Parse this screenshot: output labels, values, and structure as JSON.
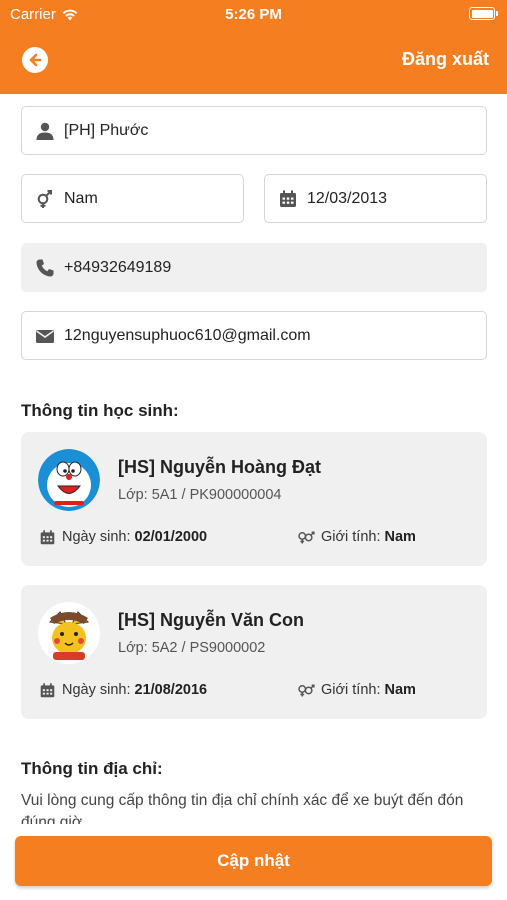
{
  "status_bar": {
    "carrier": "Carrier",
    "time": "5:26 PM"
  },
  "header": {
    "logout_label": "Đăng xuất"
  },
  "form": {
    "name": "[PH] Phước",
    "gender": "Nam",
    "birthday": "12/03/2013",
    "phone": "+84932649189",
    "email": "12nguyensuphuoc610@gmail.com"
  },
  "students_section": {
    "title": "Thông tin học sinh:",
    "students": [
      {
        "name": "[HS] Nguyễn Hoàng Đạt",
        "class": "Lớp: 5A1 / PK900000004",
        "dob_label": "Ngày sinh:",
        "dob": "02/01/2000",
        "gender_label": "Giới tính:",
        "gender": "Nam"
      },
      {
        "name": "[HS] Nguyễn Văn Con",
        "class": "Lớp: 5A2 / PS9000002",
        "dob_label": "Ngày sinh:",
        "dob": "21/08/2016",
        "gender_label": "Giới tính:",
        "gender": "Nam"
      }
    ]
  },
  "address_section": {
    "title": "Thông tin địa chỉ:",
    "description": "Vui lòng cung cấp thông tin địa chỉ chính xác để xe buýt đến đón đúng giờ"
  },
  "footer": {
    "update_label": "Cập nhật"
  },
  "colors": {
    "accent": "#f47e20",
    "field_border": "#d6d6d6",
    "card_bg": "#f0f0f0"
  }
}
